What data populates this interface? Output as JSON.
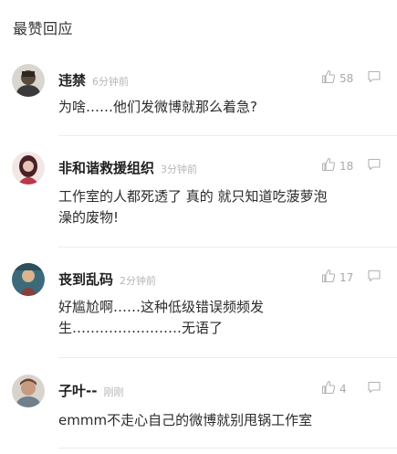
{
  "section": {
    "title": "最赞回应"
  },
  "comments": [
    {
      "username": "违禁",
      "time": "6分钟前",
      "likes": "58",
      "lines": [
        "为啥……他们发微博就那么着急?"
      ]
    },
    {
      "username": "非和谐救援组织",
      "time": "3分钟前",
      "likes": "18",
      "lines": [
        "工作室的人都死透了 真的  就只知道吃菠萝泡",
        "澡的废物!"
      ]
    },
    {
      "username": "丧到乱码",
      "time": "2分钟前",
      "likes": "17",
      "lines": [
        "好尴尬啊……这种低级错误频频发",
        "生……………………无语了"
      ]
    },
    {
      "username": "子叶--",
      "time": "刚刚",
      "likes": "4",
      "lines": [
        "emmm不走心自己的微博就别甩锅工作室"
      ]
    }
  ],
  "icons": {
    "like": "thumbs-up-icon",
    "reply": "comment-bubble-icon"
  },
  "colors": {
    "username": "#1f1f1f",
    "time": "#b6b6b6",
    "icon": "#b3b3b3",
    "divider": "#ededed"
  }
}
